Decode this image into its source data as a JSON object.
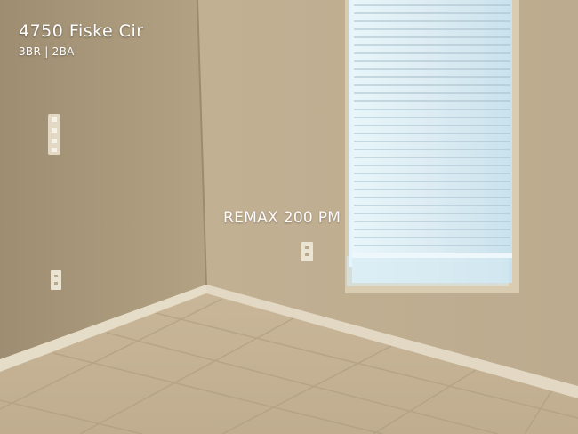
{
  "listing": {
    "address": "4750 Fiske Cir",
    "details": "3BR | 2BA"
  },
  "watermark": {
    "text": "REMAX 200 PM"
  },
  "colors": {
    "wall_left": "#a8977a",
    "wall_right": "#c4b294",
    "floor": "#c8b597",
    "baseboard": "#e6ddc9",
    "window_glow": "#cfe6f2"
  }
}
